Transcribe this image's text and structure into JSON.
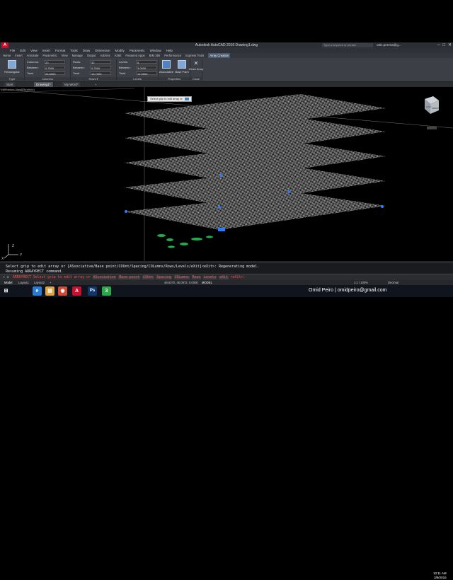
{
  "app": {
    "title": "Autodesk AutoCAD 2016   Drawing1.dwg",
    "search_placeholder": "Type a keyword or phrase",
    "user": "ortiz.pereira@g...",
    "logo_letter": "A"
  },
  "menubar": [
    "File",
    "Edit",
    "View",
    "Insert",
    "Format",
    "Tools",
    "Draw",
    "Dimension",
    "Modify",
    "Parametric",
    "Window",
    "Help"
  ],
  "ribbon_tabs": [
    "Home",
    "Insert",
    "Annotate",
    "Parametric",
    "View",
    "Manage",
    "Output",
    "Add-ins",
    "A360",
    "Featured Apps",
    "BIM 360",
    "Performance",
    "Express Tools",
    "Array Creation"
  ],
  "ribbon_active_tab": "Array Creation",
  "ribbon": {
    "type": {
      "button": "Rectangular",
      "label": "Type"
    },
    "columns": {
      "label": "Columns",
      "fields": [
        {
          "name": "Columns:",
          "value": "20"
        },
        {
          "name": "Between:",
          "value": "0.7500"
        },
        {
          "name": "Total:",
          "value": "26.6000"
        }
      ]
    },
    "rows": {
      "label": "Rows ▾",
      "fields": [
        {
          "name": "Rows:",
          "value": "32"
        },
        {
          "name": "Between:",
          "value": "0.7500"
        },
        {
          "name": "Total:",
          "value": "13.7000"
        }
      ]
    },
    "levels": {
      "label": "Levels",
      "fields": [
        {
          "name": "Levels:",
          "value": "5"
        },
        {
          "name": "Between:",
          "value": "3.0000"
        },
        {
          "name": "Total:",
          "value": "12.0000"
        }
      ]
    },
    "properties": {
      "label": "Properties",
      "buttons": [
        "Associative",
        "Base Point"
      ]
    },
    "close": {
      "label": "Close",
      "button": "Close Array"
    }
  },
  "doc_tabs": [
    "Start",
    "Drawing1*",
    "My Word*"
  ],
  "viewport": {
    "label": "[-][Custom View][Realistic]",
    "tooltip": "Select grip to edit array or",
    "viewcube": {
      "left": "LEFT",
      "front": "FRONT"
    }
  },
  "command_history": [
    "Select grip to edit array or [ASsociative/Base point/COUnt/Spacing/COLumns/Rows/Levels/eXit]<eXit>:  Regenerating model.",
    "Resuming ARRAYRECT command."
  ],
  "command_line": {
    "prefix": "ARRAYRECT",
    "text": "Select grip to edit array or",
    "options": [
      "ASsociative",
      "Base point",
      "COUnt",
      "Spacing",
      "COLumns",
      "Rows",
      "Levels",
      "eXit"
    ],
    "suffix": "<eXit>:"
  },
  "layout_tabs": [
    "Model",
    "Layout1",
    "Layout2",
    "+"
  ],
  "statusbar": {
    "coords": "48.6370, 45.0972, 0.0000",
    "mode": "MODEL",
    "scale": "1:1 / 100%",
    "units": "Decimal"
  },
  "taskbar": {
    "icons": [
      {
        "name": "start",
        "glyph": "⊞",
        "color": "#1f6fd0"
      },
      {
        "name": "ie",
        "glyph": "e",
        "color": "#2a7bd4"
      },
      {
        "name": "explorer",
        "glyph": "▤",
        "color": "#d9a441"
      },
      {
        "name": "chrome",
        "glyph": "◉",
        "color": "#d04a38"
      },
      {
        "name": "autocad",
        "glyph": "A",
        "color": "#c8102e"
      },
      {
        "name": "photoshop",
        "glyph": "Ps",
        "color": "#11366b"
      },
      {
        "name": "camtasia",
        "glyph": "3",
        "color": "#2aa84a"
      }
    ],
    "clock_time": "10:11 AM",
    "clock_date": "3/9/2016"
  },
  "watermark": "Omid Peiro | omidpeiro@gmail.com"
}
